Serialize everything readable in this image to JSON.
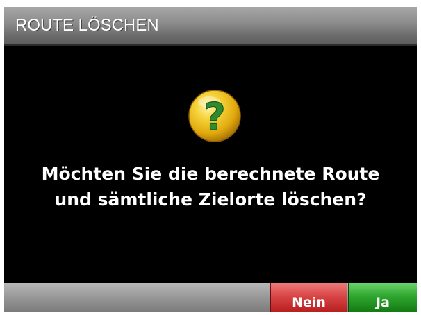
{
  "dialog": {
    "title": "ROUTE LÖSCHEN",
    "icon": "question-mark-icon",
    "message_line1": "Möchten Sie die berechnete Route",
    "message_line2": "und sämtliche Zielorte löschen?"
  },
  "buttons": {
    "no_label": "Nein",
    "yes_label": "Ja"
  },
  "colors": {
    "background": "#000000",
    "title_bar": "#8e8e8e",
    "no_button": "#d84545",
    "yes_button": "#2fa62f",
    "icon": "#f2c21a",
    "icon_glyph": "#2e8b2e"
  }
}
